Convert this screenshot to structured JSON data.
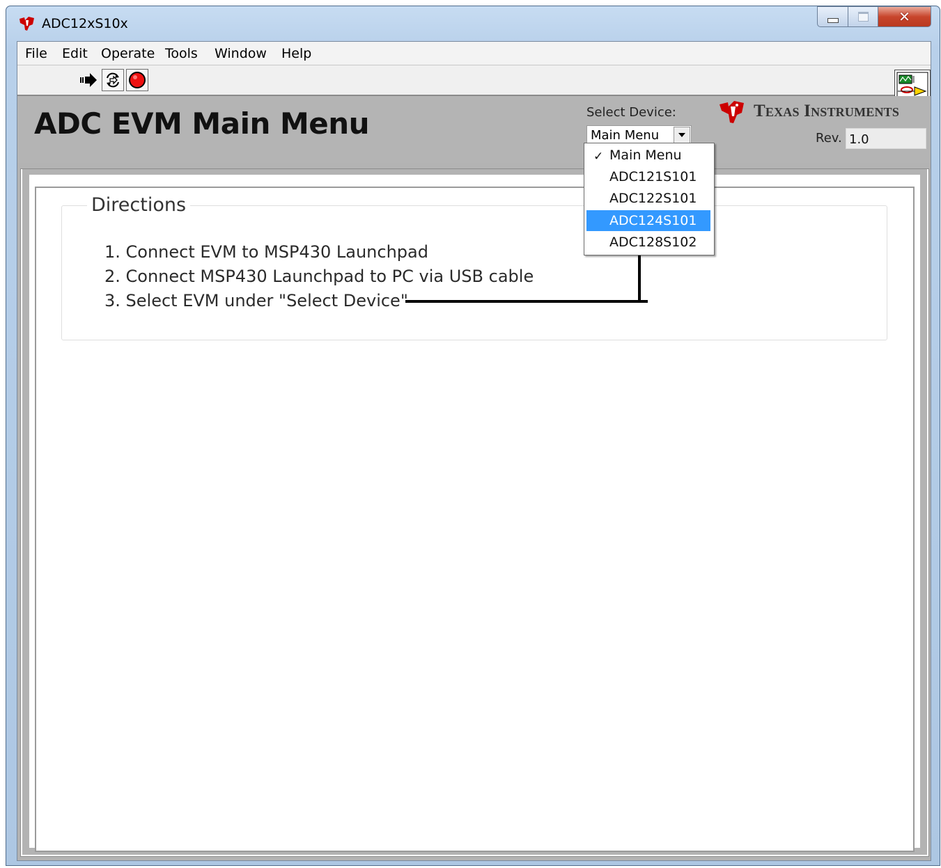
{
  "window": {
    "title": "ADC12xS10x"
  },
  "menubar": {
    "items": [
      {
        "label": "File"
      },
      {
        "label": "Edit"
      },
      {
        "label": "Operate"
      },
      {
        "label": "Tools"
      },
      {
        "label": "Window"
      },
      {
        "label": "Help"
      }
    ]
  },
  "toolbar": {
    "run_icon": "run-arrow-icon",
    "run_continuous_icon": "run-continuously-icon",
    "abort_icon": "abort-stop-icon",
    "vi_icon_number": "1"
  },
  "header": {
    "title": "ADC EVM Main Menu",
    "select_device_label": "Select Device:",
    "select_device_value": "Main Menu",
    "brand": "Texas Instruments",
    "rev_label": "Rev.",
    "rev_value": "1.0"
  },
  "directions": {
    "legend": "Directions",
    "steps": [
      "1. Connect EVM to MSP430 Launchpad",
      "2. Connect MSP430 Launchpad to PC via USB cable",
      "3. Select EVM under \"Select Device\""
    ]
  },
  "dropdown": {
    "items": [
      {
        "label": "Main Menu",
        "checked": true,
        "highlighted": false
      },
      {
        "label": "ADC121S101",
        "checked": false,
        "highlighted": false
      },
      {
        "label": "ADC122S101",
        "checked": false,
        "highlighted": false
      },
      {
        "label": "ADC124S101",
        "checked": false,
        "highlighted": true
      },
      {
        "label": "ADC128S102",
        "checked": false,
        "highlighted": false
      }
    ],
    "check_glyph": "✓"
  },
  "colors": {
    "ti_red": "#cc0000",
    "highlight": "#3399ff",
    "panel_gray": "#b4b4b4"
  }
}
